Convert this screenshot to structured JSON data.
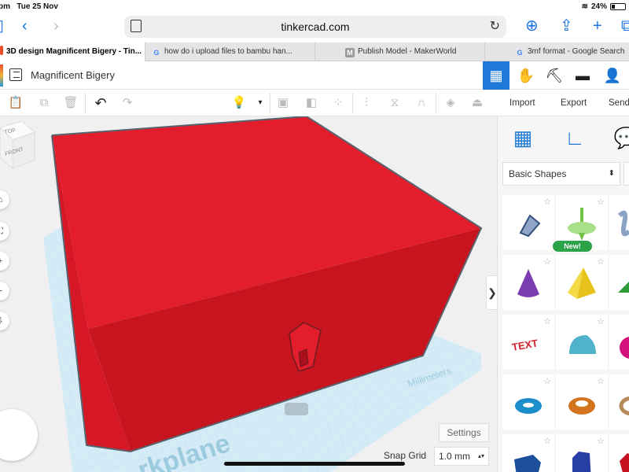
{
  "status_bar": {
    "time": "pm",
    "date": "Tue 25 Nov",
    "battery": "24%"
  },
  "browser": {
    "url": "tinkercad.com",
    "tabs": [
      {
        "title": "3D design Magnificent Bigery - Tin...",
        "active": true
      },
      {
        "title": "how do i upload files to bambu han...",
        "active": false
      },
      {
        "title": "Publish Model - MakerWorld",
        "active": false
      },
      {
        "title": "3mf format - Google Search",
        "active": false
      }
    ]
  },
  "tinkercad": {
    "design_title": "Magnificent Bigery",
    "actions": {
      "import": "Import",
      "export": "Export",
      "send": "Send"
    },
    "viewcube": {
      "top": "TOP",
      "front": "FRONT"
    },
    "workplane": {
      "label": "rkplane",
      "units": "Millimeters"
    },
    "settings_label": "Settings",
    "snap_grid": {
      "label": "Snap Grid",
      "value": "1.0 mm"
    }
  },
  "shapes_panel": {
    "category": "Basic Shapes",
    "new_badge": "New!",
    "text_shape": "TEXT",
    "tiles": [
      {
        "name": "scribble"
      },
      {
        "name": "spinning-top",
        "badge": "New!"
      },
      {
        "name": "spring"
      },
      {
        "name": "cone"
      },
      {
        "name": "pyramid"
      },
      {
        "name": "roof"
      },
      {
        "name": "text"
      },
      {
        "name": "half-cylinder"
      },
      {
        "name": "sphere"
      },
      {
        "name": "torus"
      },
      {
        "name": "tube"
      },
      {
        "name": "ring"
      },
      {
        "name": "polygon"
      },
      {
        "name": "cylinder"
      },
      {
        "name": "gem"
      }
    ]
  },
  "colors": {
    "box_red": "#e41d2c",
    "accent_blue": "#1e7ad6",
    "grid_blue": "#c8e6f2"
  }
}
